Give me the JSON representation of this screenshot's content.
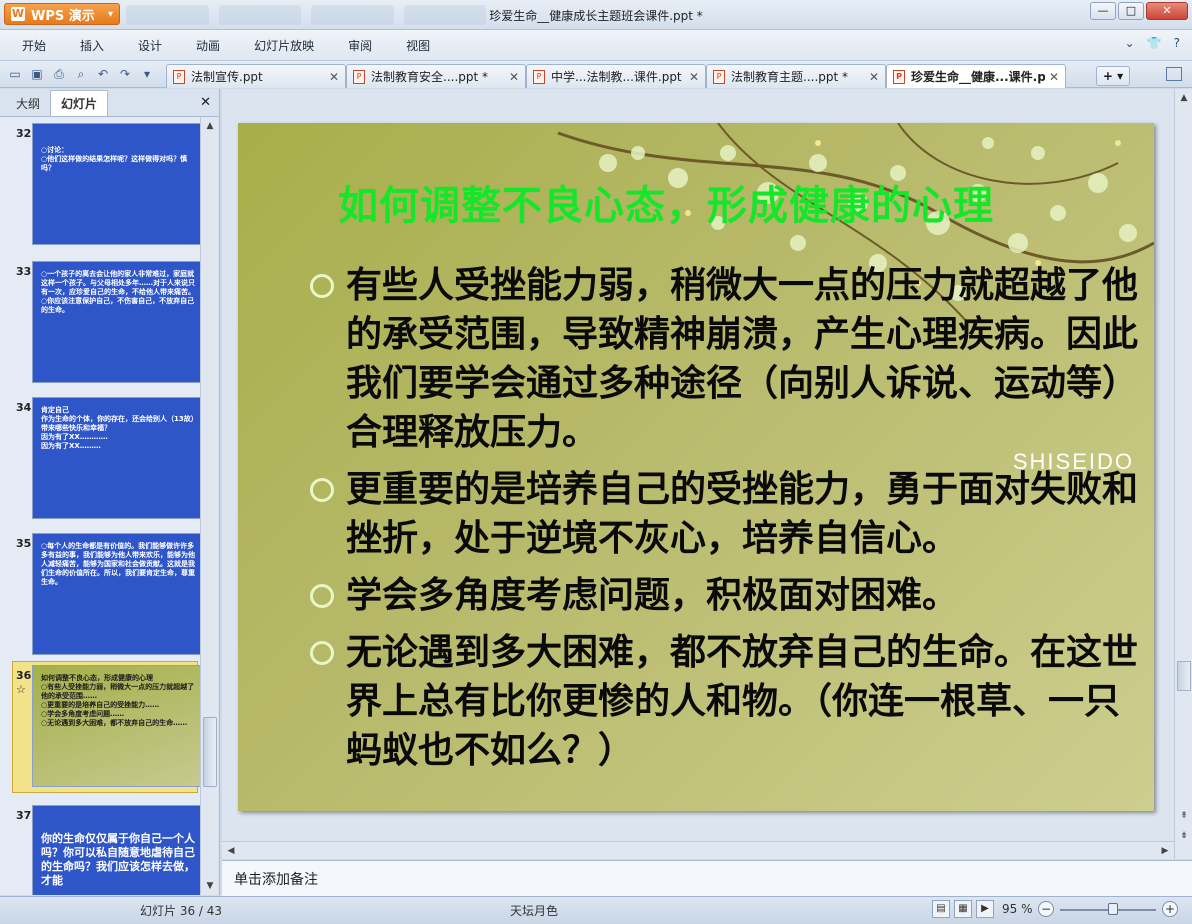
{
  "app": {
    "name": "WPS 演示",
    "document_title": "珍爱生命__健康成长主题班会课件.ppt *"
  },
  "menu": [
    "开始",
    "插入",
    "设计",
    "动画",
    "幻灯片放映",
    "审阅",
    "视图"
  ],
  "tabs": [
    {
      "label": "法制宣传.ppt",
      "active": false
    },
    {
      "label": "法制教育安全....ppt *",
      "active": false
    },
    {
      "label": "中学...法制教...课件.ppt",
      "active": false
    },
    {
      "label": "法制教育主题....ppt *",
      "active": false
    },
    {
      "label": "珍爱生命__健康...课件.ppt *",
      "active": true
    }
  ],
  "panel": {
    "tab_outline": "大纲",
    "tab_slides": "幻灯片"
  },
  "thumbnails": [
    {
      "num": "32",
      "text": "○讨论：\n○他们这样做的结果怎样呢？这样做得对吗？慎吗？"
    },
    {
      "num": "33",
      "text": "○一个孩子的离去会让他的家人非常难过，家庭就这样一个孩子。与父母相处多年……对于人来说只有一次，应珍爱自己的生命，不给他人带来痛苦。\n○你应该注意保护自己，不伤害自己，不放弃自己的生命。"
    },
    {
      "num": "34",
      "text": "肯定自己\n作为生命的个体，你的存在，还会给别人（13故）带来哪些快乐和幸福？\n因为有了XX…………\n因为有了XX………"
    },
    {
      "num": "35",
      "text": "○每个人的生命都是有价值的。我们能够做许许多多有益的事，我们能够为他人带来欢乐，能够为他人减轻痛苦，能够为国家和社会做贡献。这就是我们生命的价值所在。所以，我们要肯定生命，尊重生命。"
    },
    {
      "num": "36",
      "text": "如何调整不良心态，形成健康的心理\n○有些人受挫能力弱，稍微大一点的压力就超越了他的承受范围……\n○更重要的是培养自己的受挫能力……\n○学会多角度考虑问题……\n○无论遇到多大困难，都不放弃自己的生命……",
      "star": "☆"
    },
    {
      "num": "37",
      "text": "你的生命仅仅属于你自己一个人吗？你可以私自随意地虐待自己的生命吗？我们应该怎样去做，才能"
    }
  ],
  "slide": {
    "title": "如何调整不良心态，形成健康的心理",
    "bullets": [
      "有些人受挫能力弱，稍微大一点的压力就超越了他的承受范围，导致精神崩溃，产生心理疾病。因此我们要学会通过多种途径（向别人诉说、运动等）合理释放压力。",
      "更重要的是培养自己的受挫能力，勇于面对失败和挫折，处于逆境不灰心，培养自信心。",
      "学会多角度考虑问题，积极面对困难。",
      "无论遇到多大困难，都不放弃自己的生命。在这世界上总有比你更惨的人和物。（你连一根草、一只蚂蚁也不如么？）"
    ],
    "brand": "SHISEIDO",
    "colors": {
      "title": "#16e62a",
      "bullet_marker": "#e8f6c8",
      "background": "#b8ba6c"
    }
  },
  "notes_placeholder": "单击添加备注",
  "status": {
    "slide_counter": "幻灯片 36 / 43",
    "theme": "天坛月色",
    "zoom": "95 %"
  },
  "zoom_fraction": 0.55,
  "icons": [
    "wps-logo-icon",
    "minimize-icon",
    "maximize-icon",
    "close-icon",
    "help-icon",
    "skin-icon"
  ]
}
